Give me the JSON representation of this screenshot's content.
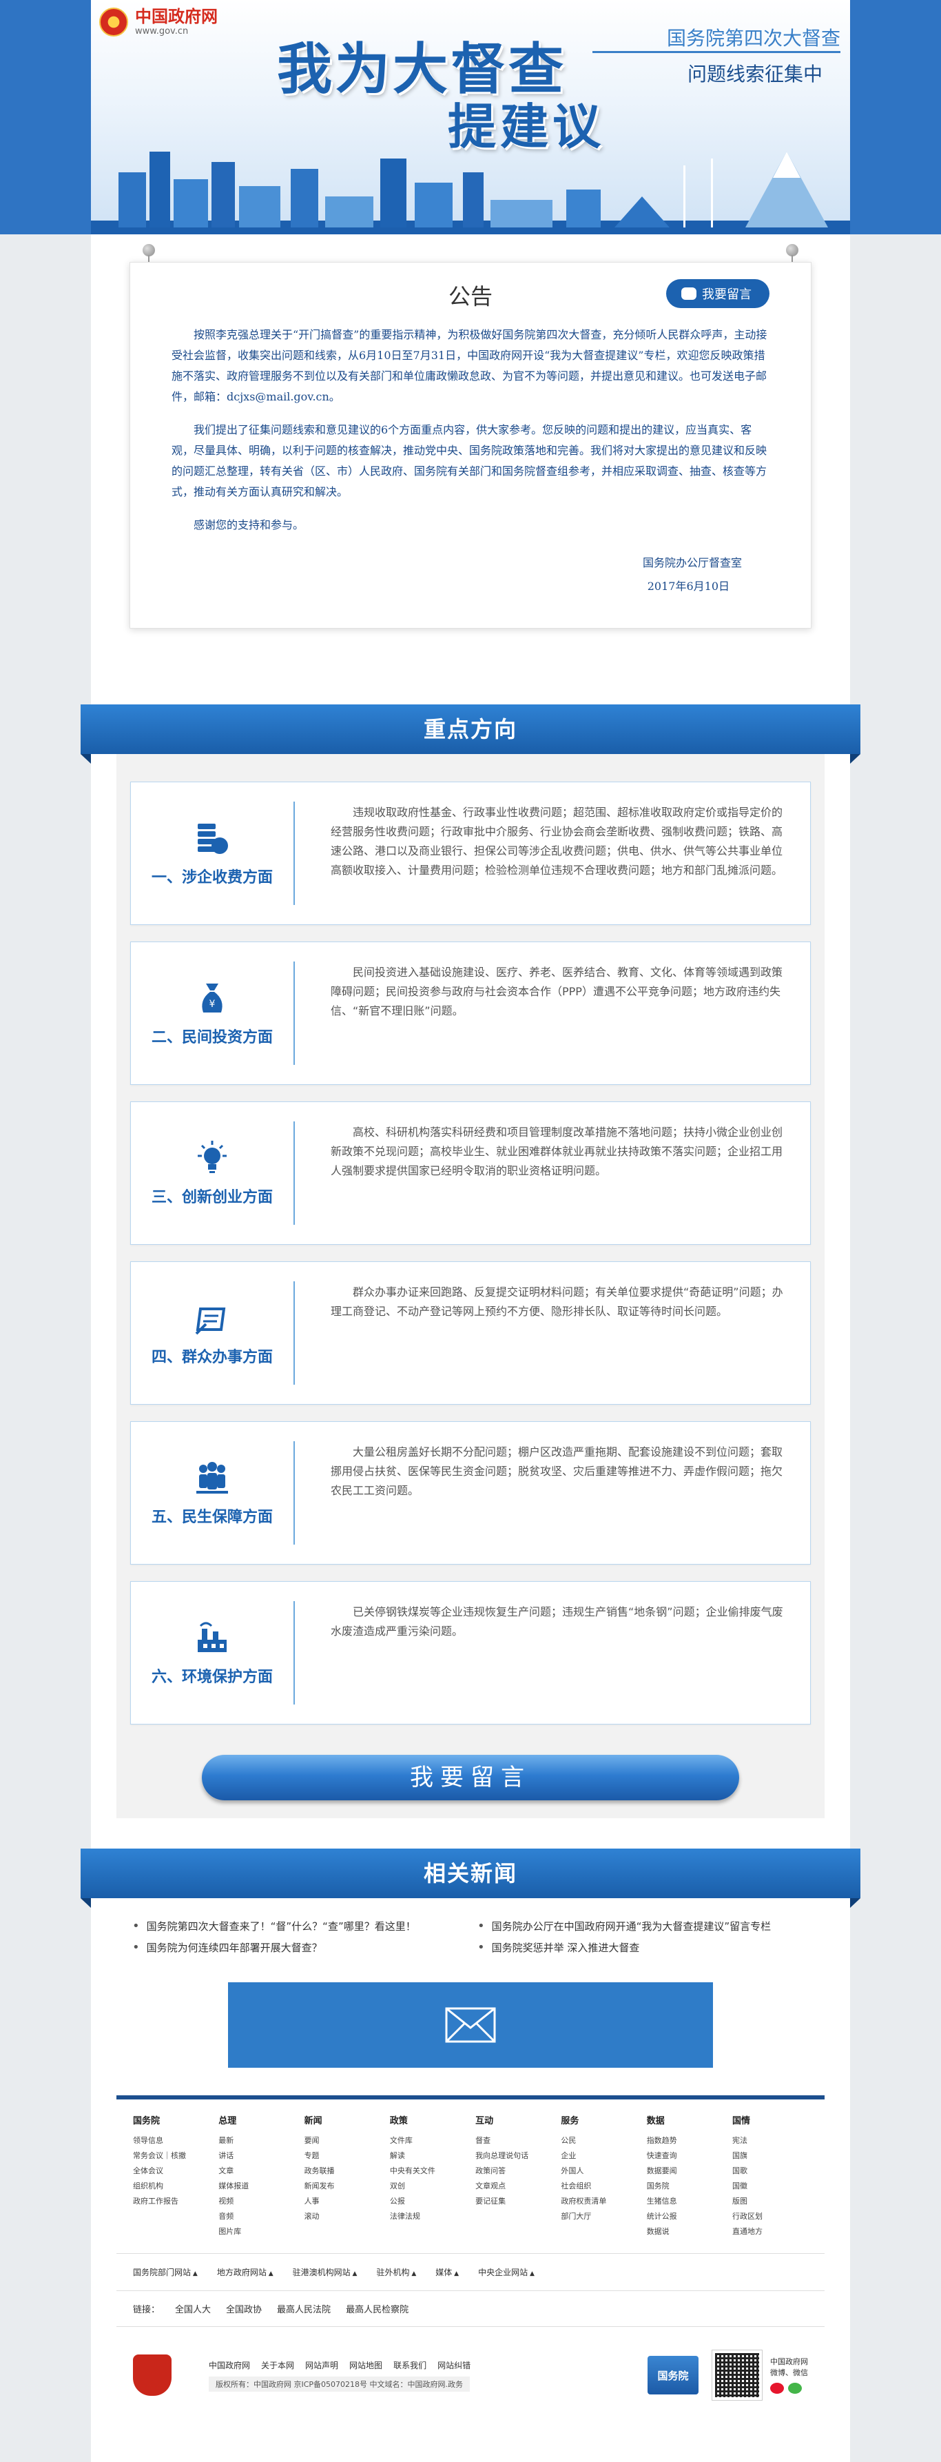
{
  "banner": {
    "site_name": "中国政府网",
    "site_url": "www.gov.cn",
    "title_line1": "我为大督查",
    "title_line2": "提建议",
    "subtitle_top": "国务院第四次大督查",
    "subtitle_bottom": "问题线索征集中"
  },
  "notice": {
    "title": "公告",
    "message_button": "我要留言",
    "paragraphs": [
      "按照李克强总理关于“开门搞督查”的重要指示精神，为积极做好国务院第四次大督查，充分倾听人民群众呼声，主动接受社会监督，收集突出问题和线索，从6月10日至7月31日，中国政府网开设“我为大督查提建议”专栏，欢迎您反映政策措施不落实、政府管理服务不到位以及有关部门和单位庸政懒政怠政、为官不为等问题，并提出意见和建议。也可发送电子邮件，邮箱：dcjxs@mail.gov.cn。",
      "我们提出了征集问题线索和意见建议的6个方面重点内容，供大家参考。您反映的问题和提出的建议，应当真实、客观，尽量具体、明确，以利于问题的核查解决，推动党中央、国务院政策落地和完善。我们将对大家提出的意见建议和反映的问题汇总整理，转有关省（区、市）人民政府、国务院有关部门和国务院督查组参考，并相应采取调查、抽查、核查等方式，推动有关方面认真研究和解决。",
      "感谢您的支持和参与。"
    ],
    "signature": "国务院办公厅督查室",
    "date": "2017年6月10日"
  },
  "focus": {
    "heading": "重点方向",
    "cards": [
      {
        "icon": "coins-icon",
        "title": "一、涉企收费方面",
        "text": "违规收取政府性基金、行政事业性收费问题；超范围、超标准收取政府定价或指导定价的经营服务性收费问题；行政审批中介服务、行业协会商会垄断收费、强制收费问题；铁路、高速公路、港口以及商业银行、担保公司等涉企乱收费问题；供电、供水、供气等公共事业单位高额收取接入、计量费用问题；检验检测单位违规不合理收费问题；地方和部门乱摊派问题。"
      },
      {
        "icon": "money-bag-icon",
        "title": "二、民间投资方面",
        "text": "民间投资进入基础设施建设、医疗、养老、医养结合、教育、文化、体育等领域遇到政策障碍问题；民间投资参与政府与社会资本合作（PPP）遭遇不公平竞争问题；地方政府违约失信、“新官不理旧账”问题。"
      },
      {
        "icon": "lightbulb-icon",
        "title": "三、创新创业方面",
        "text": "高校、科研机构落实科研经费和项目管理制度改革措施不落地问题；扶持小微企业创业创新政策不兑现问题；高校毕业生、就业困难群体就业再就业扶持政策不落实问题；企业招工用人强制要求提供国家已经明令取消的职业资格证明问题。"
      },
      {
        "icon": "document-pen-icon",
        "title": "四、群众办事方面",
        "text": "群众办事办证来回跑路、反复提交证明材料问题；有关单位要求提供“奇葩证明”问题；办理工商登记、不动产登记等网上预约不方便、隐形排长队、取证等待时间长问题。"
      },
      {
        "icon": "people-icon",
        "title": "五、民生保障方面",
        "text": "大量公租房盖好长期不分配问题；棚户区改造严重拖期、配套设施建设不到位问题；套取挪用侵占扶贫、医保等民生资金问题；脱贫攻坚、灾后重建等推进不力、弄虚作假问题；拖欠农民工工资问题。"
      },
      {
        "icon": "factory-icon",
        "title": "六、环境保护方面",
        "text": "已关停钢铁煤炭等企业违规恢复生产问题；违规生产销售“地条钢”问题；企业偷排废气废水废渣造成严重污染问题。"
      }
    ],
    "cta": "我要留言"
  },
  "news": {
    "heading": "相关新闻",
    "items": [
      "国务院第四次大督查来了！“督”什么？“查”哪里？看这里！",
      "国务院办公厅在中国政府网开通“我为大督查提建议”留言专栏",
      "国务院为何连续四年部署开展大督查？",
      "国务院奖惩并举 深入推进大督查"
    ]
  },
  "footer": {
    "columns": [
      {
        "head": "国务院",
        "items": [
          "领导信息",
          "常务会议｜核撤",
          "全体会议",
          "组织机构",
          "政府工作报告"
        ]
      },
      {
        "head": "总理",
        "items": [
          "最新",
          "讲话",
          "文章",
          "媒体报道",
          "视频",
          "音频",
          "图片库"
        ]
      },
      {
        "head": "新闻",
        "items": [
          "要闻",
          "专题",
          "政务联播",
          "新闻发布",
          "人事",
          "滚动"
        ]
      },
      {
        "head": "政策",
        "items": [
          "文件库",
          "解读",
          "中央有关文件",
          "双创",
          "公报",
          "法律法规"
        ]
      },
      {
        "head": "互动",
        "items": [
          "督查",
          "我向总理说句话",
          "政策问答",
          "文章观点",
          "要记征集"
        ]
      },
      {
        "head": "服务",
        "items": [
          "公民",
          "企业",
          "外国人",
          "社会组织",
          "政府权责清单",
          "部门大厅"
        ]
      },
      {
        "head": "数据",
        "items": [
          "指数趋势",
          "快速查询",
          "数据要闻",
          "国务院",
          "生猪信息",
          "统计公报",
          "数据说"
        ]
      },
      {
        "head": "国情",
        "items": [
          "宪法",
          "国旗",
          "国歌",
          "国徽",
          "版图",
          "行政区划",
          "直通地方"
        ]
      }
    ],
    "site_groups": [
      "国务院部门网站",
      "地方政府网站",
      "驻港澳机构网站",
      "驻外机构",
      "媒体",
      "中央企业网站"
    ],
    "links_label": "链接：",
    "links": [
      "全国人大",
      "全国政协",
      "最高人民法院",
      "最高人民检察院"
    ],
    "bottom_links": [
      "中国政府网",
      "关于本网",
      "网站声明",
      "网站地图",
      "联系我们",
      "网站纠错"
    ],
    "copyright": "版权所有：中国政府网 京ICP备05070218号 中文域名：中国政府网.政务",
    "gwy_label": "国务院",
    "social_label": "中国政府网\n微博、微信"
  }
}
